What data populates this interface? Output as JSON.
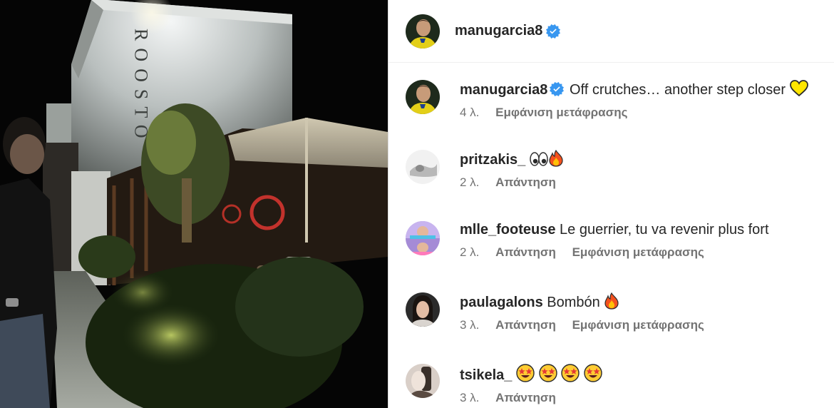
{
  "post": {
    "username": "manugarcia8",
    "verified": true,
    "sign_text": "ROOSTO"
  },
  "comments": [
    {
      "username": "manugarcia8",
      "verified": true,
      "text": "Off crutches… another step closer",
      "emoji": [
        "yellow-heart-icon"
      ],
      "time": "4 λ.",
      "actions": [
        "Εμφάνιση μετάφρασης"
      ]
    },
    {
      "username": "pritzakis_",
      "verified": false,
      "text": "",
      "emoji": [
        "eyes-icon",
        "fire-icon"
      ],
      "time": "2 λ.",
      "actions": [
        "Απάντηση"
      ]
    },
    {
      "username": "mlle_footeuse",
      "verified": false,
      "text": "Le guerrier, tu va revenir plus fort",
      "emoji": [],
      "time": "2 λ.",
      "actions": [
        "Απάντηση",
        "Εμφάνιση μετάφρασης"
      ]
    },
    {
      "username": "paulagalons",
      "verified": false,
      "text": "Bombón",
      "emoji": [
        "fire-icon"
      ],
      "time": "3 λ.",
      "actions": [
        "Απάντηση",
        "Εμφάνιση μετάφρασης"
      ]
    },
    {
      "username": "tsikela_",
      "verified": false,
      "text": "",
      "emoji": [
        "star-struck-icon",
        "star-struck-icon",
        "star-struck-icon",
        "star-struck-icon"
      ],
      "time": "3 λ.",
      "actions": [
        "Απάντηση"
      ]
    }
  ],
  "colors": {
    "verified_badge": "#3897f0",
    "text_primary": "#262626",
    "text_secondary": "#737373"
  }
}
